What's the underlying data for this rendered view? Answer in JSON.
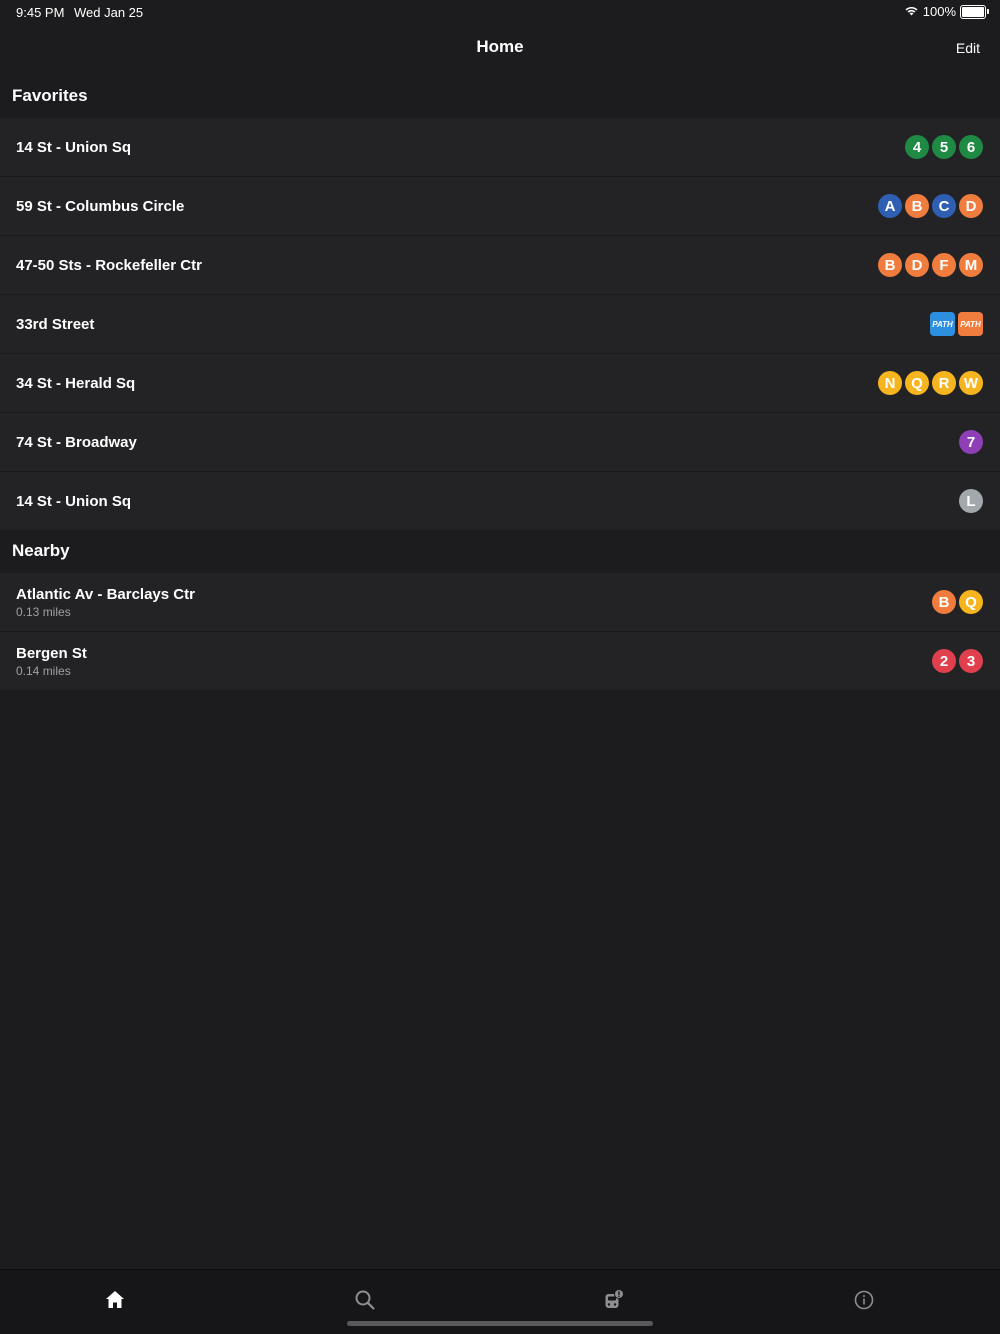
{
  "status_bar": {
    "time": "9:45 PM",
    "date": "Wed Jan 25",
    "battery": "100%",
    "wifi_icon": "wifi-icon",
    "battery_icon": "battery-icon"
  },
  "nav": {
    "title": "Home",
    "edit_label": "Edit"
  },
  "favorites": {
    "header": "Favorites",
    "items": [
      {
        "name": "14 St - Union Sq",
        "lines": [
          {
            "label": "4",
            "color": "#1e8a43"
          },
          {
            "label": "5",
            "color": "#1e8a43"
          },
          {
            "label": "6",
            "color": "#1e8a43"
          }
        ]
      },
      {
        "name": "59 St - Columbus Circle",
        "lines": [
          {
            "label": "A",
            "color": "#2f5fb3"
          },
          {
            "label": "B",
            "color": "#f07d3e"
          },
          {
            "label": "C",
            "color": "#2f5fb3"
          },
          {
            "label": "D",
            "color": "#f07d3e"
          }
        ]
      },
      {
        "name": "47-50 Sts - Rockefeller Ctr",
        "lines": [
          {
            "label": "B",
            "color": "#f07d3e"
          },
          {
            "label": "D",
            "color": "#f07d3e"
          },
          {
            "label": "F",
            "color": "#f07d3e"
          },
          {
            "label": "M",
            "color": "#f07d3e"
          }
        ]
      },
      {
        "name": "33rd Street",
        "lines": [
          {
            "label": "PATH",
            "color": "#2d8fe0"
          },
          {
            "label": "PATH",
            "color": "#f07d3e"
          }
        ]
      },
      {
        "name": "34 St - Herald Sq",
        "lines": [
          {
            "label": "N",
            "color": "#f6b41f"
          },
          {
            "label": "Q",
            "color": "#f6b41f"
          },
          {
            "label": "R",
            "color": "#f6b41f"
          },
          {
            "label": "W",
            "color": "#f6b41f"
          }
        ]
      },
      {
        "name": "74 St - Broadway",
        "lines": [
          {
            "label": "7",
            "color": "#8e3fb6"
          }
        ]
      },
      {
        "name": "14 St - Union Sq",
        "lines": [
          {
            "label": "L",
            "color": "#a3a8ac"
          }
        ]
      }
    ]
  },
  "nearby": {
    "header": "Nearby",
    "items": [
      {
        "name": "Atlantic Av - Barclays Ctr",
        "distance": "0.13 miles",
        "lines": [
          {
            "label": "B",
            "color": "#f07d3e"
          },
          {
            "label": "Q",
            "color": "#f6b41f"
          }
        ]
      },
      {
        "name": "Bergen St",
        "distance": "0.14 miles",
        "lines": [
          {
            "label": "2",
            "color": "#e0404e"
          },
          {
            "label": "3",
            "color": "#e0404e"
          }
        ]
      }
    ]
  },
  "tabs": [
    {
      "icon": "home-icon",
      "active": true
    },
    {
      "icon": "search-icon",
      "active": false
    },
    {
      "icon": "service-alert-icon",
      "active": false
    },
    {
      "icon": "info-icon",
      "active": false
    }
  ]
}
